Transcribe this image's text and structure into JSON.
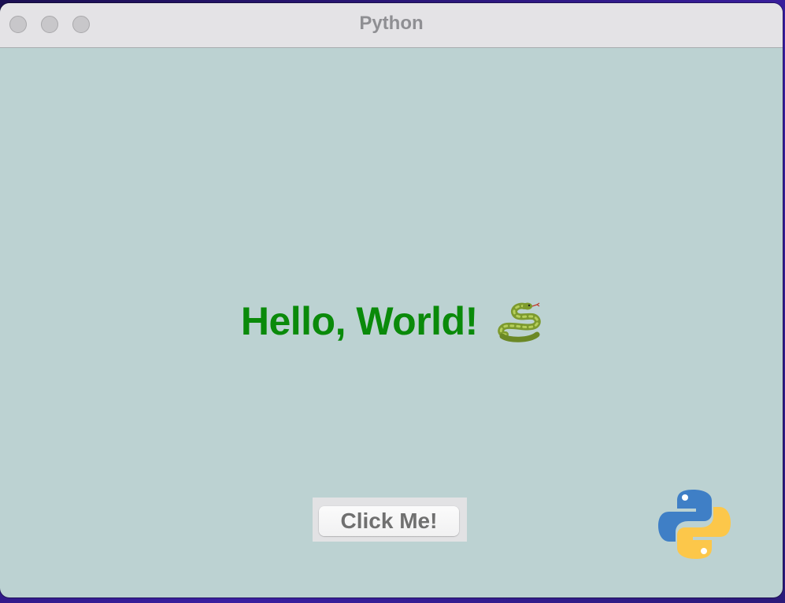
{
  "window": {
    "title": "Python"
  },
  "main": {
    "greeting": "Hello, World!",
    "button_label": "Click Me!"
  },
  "icons": {
    "greeting_icon": "snake-icon",
    "logo": "python-logo"
  },
  "colors": {
    "background": "#bcd2d2",
    "greeting_text": "#0a8a0a",
    "titlebar": "#e4e3e6",
    "python_blue": "#3f7fc6",
    "python_yellow": "#fcc74a"
  }
}
